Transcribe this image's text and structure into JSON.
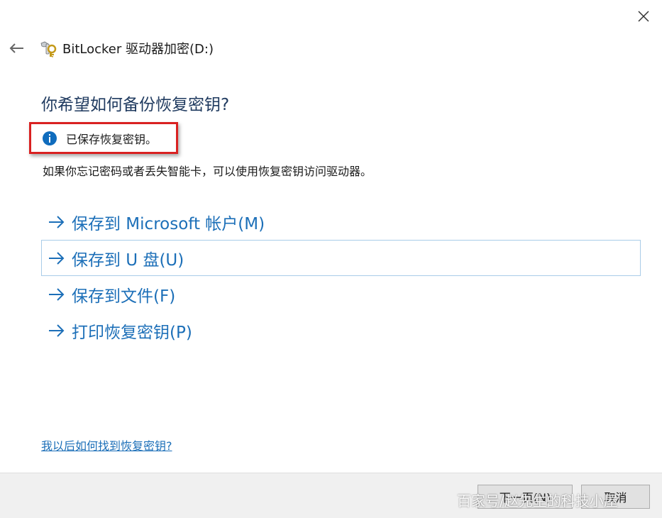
{
  "window": {
    "app_title": "BitLocker 驱动器加密(D:)",
    "close_icon": "close-icon",
    "back_icon": "arrow-left-icon",
    "app_icon": "bitlocker-key-icon"
  },
  "main": {
    "heading": "你希望如何备份恢复密钥?",
    "notice": {
      "icon": "info-icon",
      "text": "已保存恢复密钥。"
    },
    "description": "如果你忘记密码或者丢失智能卡，可以使用恢复密钥访问驱动器。",
    "options": [
      {
        "label": "保存到 Microsoft 帐户(M)",
        "icon": "arrow-right-icon"
      },
      {
        "label": "保存到 U 盘(U)",
        "icon": "arrow-right-icon",
        "selected": true
      },
      {
        "label": "保存到文件(F)",
        "icon": "arrow-right-icon"
      },
      {
        "label": "打印恢复密钥(P)",
        "icon": "arrow-right-icon"
      }
    ],
    "help_link": "我以后如何找到恢复密钥?"
  },
  "footer": {
    "next_label": "下一页(N)",
    "cancel_label": "取消"
  },
  "watermark": "百家号/赵先生的科技小屋",
  "colors": {
    "link_blue": "#1c6fb8",
    "heading": "#1f3a5f",
    "highlight_border": "#d92121",
    "info_blue": "#0f6cbd",
    "selection_border": "#a9cce8",
    "footer_bg": "#f0f0f0"
  }
}
